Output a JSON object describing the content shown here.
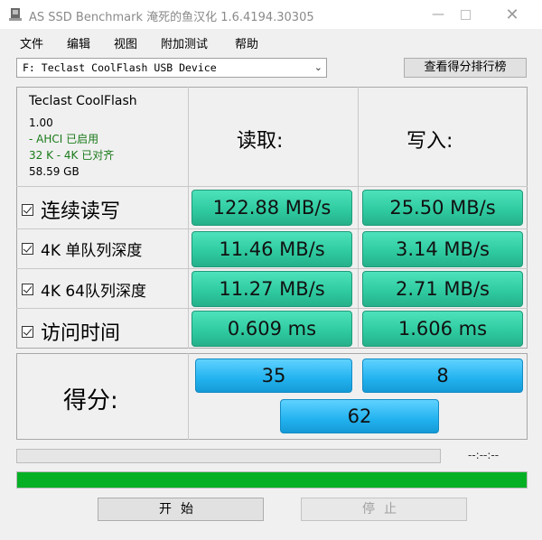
{
  "window": {
    "title": "AS SSD Benchmark 淹死的鱼汉化 1.6.4194.30305"
  },
  "menu": [
    "文件",
    "编辑",
    "视图",
    "附加测试",
    "帮助"
  ],
  "drive": {
    "selected": "F: Teclast CoolFlash USB Device",
    "rank_button": "查看得分排行榜"
  },
  "info": {
    "name": "Teclast CoolFlash",
    "version": "1.00",
    "ahci": " - AHCI 已启用",
    "align": "32 K - 4K 已对齐",
    "size": "58.59 GB"
  },
  "headers": {
    "read": "读取:",
    "write": "写入:"
  },
  "rows": [
    {
      "label": "连续读写",
      "read": "122.88 MB/s",
      "write": "25.50 MB/s"
    },
    {
      "label": "4K 单队列深度",
      "read": "11.46 MB/s",
      "write": "3.14 MB/s"
    },
    {
      "label": "4K 64队列深度",
      "read": "11.27 MB/s",
      "write": "2.71 MB/s"
    },
    {
      "label": "访问时间",
      "read": "0.609 ms",
      "write": "1.606 ms"
    }
  ],
  "score": {
    "label": "得分:",
    "read": "35",
    "write": "8",
    "total": "62"
  },
  "status": {
    "timer": "--:--:--",
    "progress_fraction": 1.0
  },
  "buttons": {
    "start": "开始",
    "stop": "停止"
  },
  "colors": {
    "result_green": "#2ec99f",
    "score_blue": "#22b2ef",
    "progress_green": "#06b025"
  }
}
